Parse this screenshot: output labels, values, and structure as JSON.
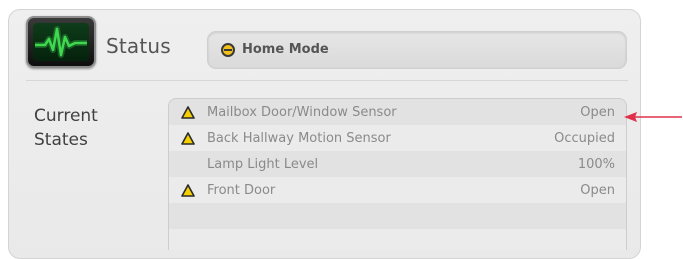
{
  "header": {
    "status_icon": "heartbeat-monitor-icon",
    "title": "Status",
    "mode_icon": "mode-indicator-icon",
    "mode_label": "Home Mode"
  },
  "current_states": {
    "label": "Current States",
    "rows": [
      {
        "name": "Mailbox Door/Window Sensor",
        "value": "Open",
        "alert": true
      },
      {
        "name": "Back Hallway Motion Sensor",
        "value": "Occupied",
        "alert": true
      },
      {
        "name": "Lamp Light Level",
        "value": "100%",
        "alert": false
      },
      {
        "name": "Front Door",
        "value": "Open",
        "alert": true
      }
    ]
  },
  "annotation": {
    "arrow_icon": "red-arrow-icon",
    "color": "#e0304a"
  },
  "colors": {
    "alert_fill": "#f5d000",
    "mode_dot": "#f2c21a",
    "monitor_green": "#3fd84f"
  }
}
